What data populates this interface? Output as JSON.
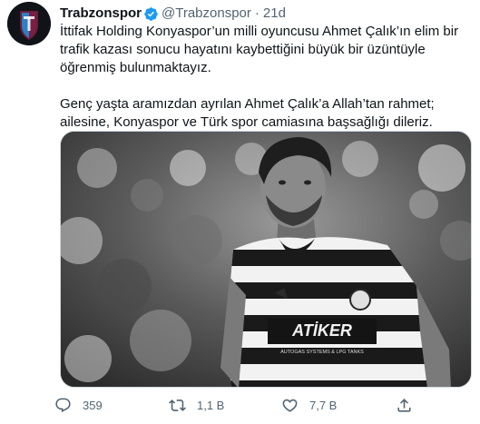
{
  "author": {
    "name": "Trabzonspor",
    "handle": "@Trabzonspor",
    "separator": "·",
    "time": "21d",
    "avatar_icon": "trabzonspor-logo",
    "verified_icon": "verified-badge-icon"
  },
  "tweet": {
    "paragraph1": "İttifak Holding Konyaspor’un milli oyuncusu Ahmet Çalık’ın elim bir trafik kazası sonucu hayatını kaybettiğini büyük bir üzüntüyle öğrenmiş bulunmaktayız.",
    "paragraph2": "Genç yaşta aramızdan ayrılan Ahmet Çalık’a Allah’tan rahmet; ailesine, Konyaspor ve Türk spor camiasına başsağlığı dileriz.",
    "image": {
      "jersey_sponsor": "ATİKER",
      "jersey_sponsor_sub": "AUTOGAS SYSTEMS & LPG TANKS"
    }
  },
  "actions": {
    "reply_count": "359",
    "retweet_count": "1,1 B",
    "like_count": "7,7 B"
  },
  "colors": {
    "text": "#0f1419",
    "secondary": "#536471",
    "verified": "#1d9bf0",
    "border": "#cfd9de"
  }
}
